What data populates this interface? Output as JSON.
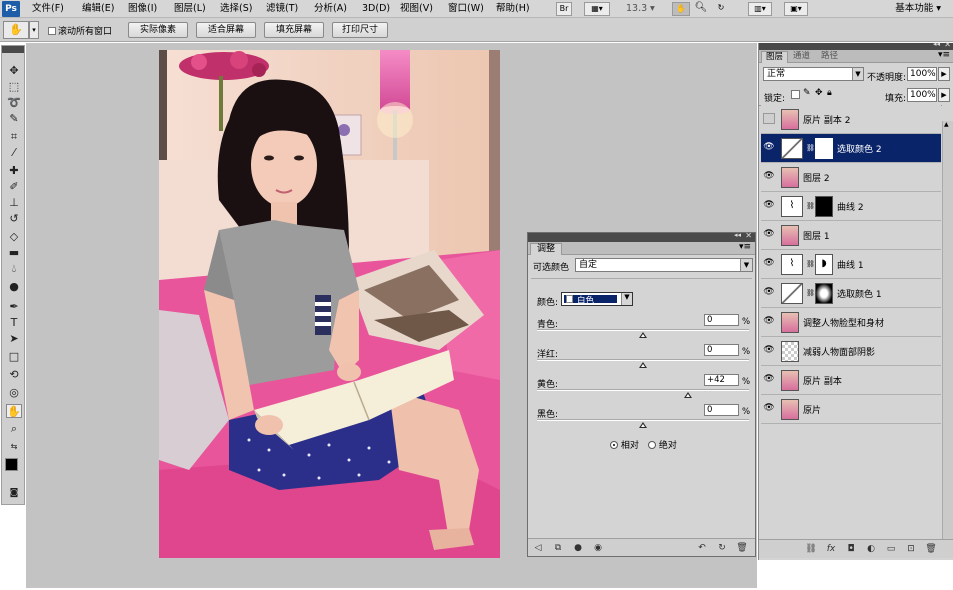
{
  "app": {
    "logo": "Ps",
    "menus": [
      "文件(F)",
      "编辑(E)",
      "图像(I)",
      "图层(L)",
      "选择(S)",
      "滤镜(T)",
      "分析(A)",
      "3D(D)",
      "视图(V)",
      "窗口(W)",
      "帮助(H)"
    ],
    "zoom": "13.3",
    "workspace": "基本功能"
  },
  "options_bar": {
    "scroll_all_label": "滚动所有窗口",
    "buttons": [
      "实际像素",
      "适合屏幕",
      "填充屏幕",
      "打印尺寸"
    ]
  },
  "tools": [
    "move-tool",
    "marquee-tool",
    "lasso-tool",
    "quick-select-tool",
    "crop-tool",
    "eyedropper-tool",
    "heal-tool",
    "brush-tool",
    "clone-tool",
    "history-brush-tool",
    "eraser-tool",
    "gradient-tool",
    "blur-tool",
    "dodge-tool",
    "pen-tool",
    "type-tool",
    "path-select-tool",
    "shape-tool",
    "3d-rotate-tool",
    "3d-orbit-tool",
    "hand-tool",
    "zoom-tool"
  ],
  "adjustments": {
    "tab": "调整",
    "preset_label": "可选颜色",
    "preset_value": "自定",
    "colors_label": "颜色:",
    "colors_value": "白色",
    "sliders": [
      {
        "label": "青色:",
        "value": "0",
        "unit": "%",
        "level": 0.5
      },
      {
        "label": "洋红:",
        "value": "0",
        "unit": "%",
        "level": 0.5
      },
      {
        "label": "黄色:",
        "value": "+42",
        "unit": "%",
        "level": 0.71
      },
      {
        "label": "黑色:",
        "value": "0",
        "unit": "%",
        "level": 0.5
      }
    ],
    "method_relative": "相对",
    "method_absolute": "绝对"
  },
  "layers": {
    "tabs": [
      "图层",
      "通道",
      "路径"
    ],
    "blend_mode": "正常",
    "opacity_label": "不透明度:",
    "opacity_value": "100%",
    "lock_label": "锁定:",
    "fill_label": "填充:",
    "fill_value": "100%",
    "items": [
      {
        "name": "原片 副本 2",
        "kind": "photo",
        "visible": false,
        "selected": false
      },
      {
        "name": "选取颜色 2",
        "kind": "adj-selective",
        "visible": true,
        "selected": true
      },
      {
        "name": "图层 2",
        "kind": "photo",
        "visible": true,
        "selected": false
      },
      {
        "name": "曲线 2",
        "kind": "adj-curves-black",
        "visible": true,
        "selected": false
      },
      {
        "name": "图层 1",
        "kind": "photo",
        "visible": true,
        "selected": false
      },
      {
        "name": "曲线 1",
        "kind": "adj-curves",
        "visible": true,
        "selected": false
      },
      {
        "name": "选取颜色 1",
        "kind": "adj-selective-mask",
        "visible": true,
        "selected": false
      },
      {
        "name": "调整人物脸型和身材",
        "kind": "photo",
        "visible": true,
        "selected": false
      },
      {
        "name": "减弱人物面部阴影",
        "kind": "transparent",
        "visible": true,
        "selected": false
      },
      {
        "name": "原片 副本",
        "kind": "photo",
        "visible": true,
        "selected": false
      },
      {
        "name": "原片",
        "kind": "photo",
        "visible": true,
        "selected": false
      }
    ]
  },
  "colors": {
    "selection": "#0a246a",
    "canvas_bg": "#c3c3c3",
    "panel_bg": "#d4d4d4",
    "sofa_pink": "#e8559a"
  }
}
